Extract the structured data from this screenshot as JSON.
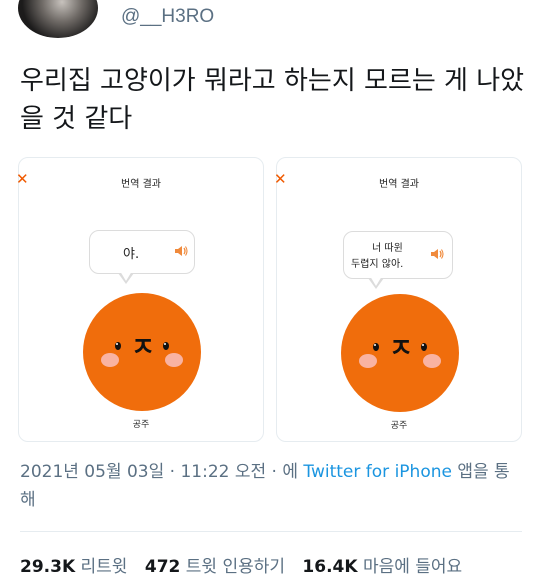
{
  "tweet": {
    "handle": "@__H3RO",
    "text": "우리집 고양이가 뭐라고 하는지 모르는 게 나았을 것 같다",
    "timestamp": "2021년 05월 03일 · 11:22 오전 · 에 ",
    "source": "Twitter for iPhone",
    "source_suffix": " 앱을 통해",
    "stats": {
      "retweets": "29.3K",
      "retweets_label": "리트윗",
      "quotes": "472",
      "quotes_label": "트윗 인용하기",
      "likes": "16.4K",
      "likes_label": "마음에 들어요"
    }
  },
  "cards": [
    {
      "close_symbol": "✕",
      "title": "번역 결과",
      "translation": "야.",
      "cat_name": "공주"
    },
    {
      "close_symbol": "✕",
      "title": "번역 결과",
      "translation_line1": "너 따윈",
      "translation_line2": "두렵지 않아.",
      "cat_name": "공주"
    }
  ],
  "colors": {
    "accent_orange": "#f06d0c",
    "link_blue": "#1b95e0",
    "muted_text": "#5b7083"
  }
}
